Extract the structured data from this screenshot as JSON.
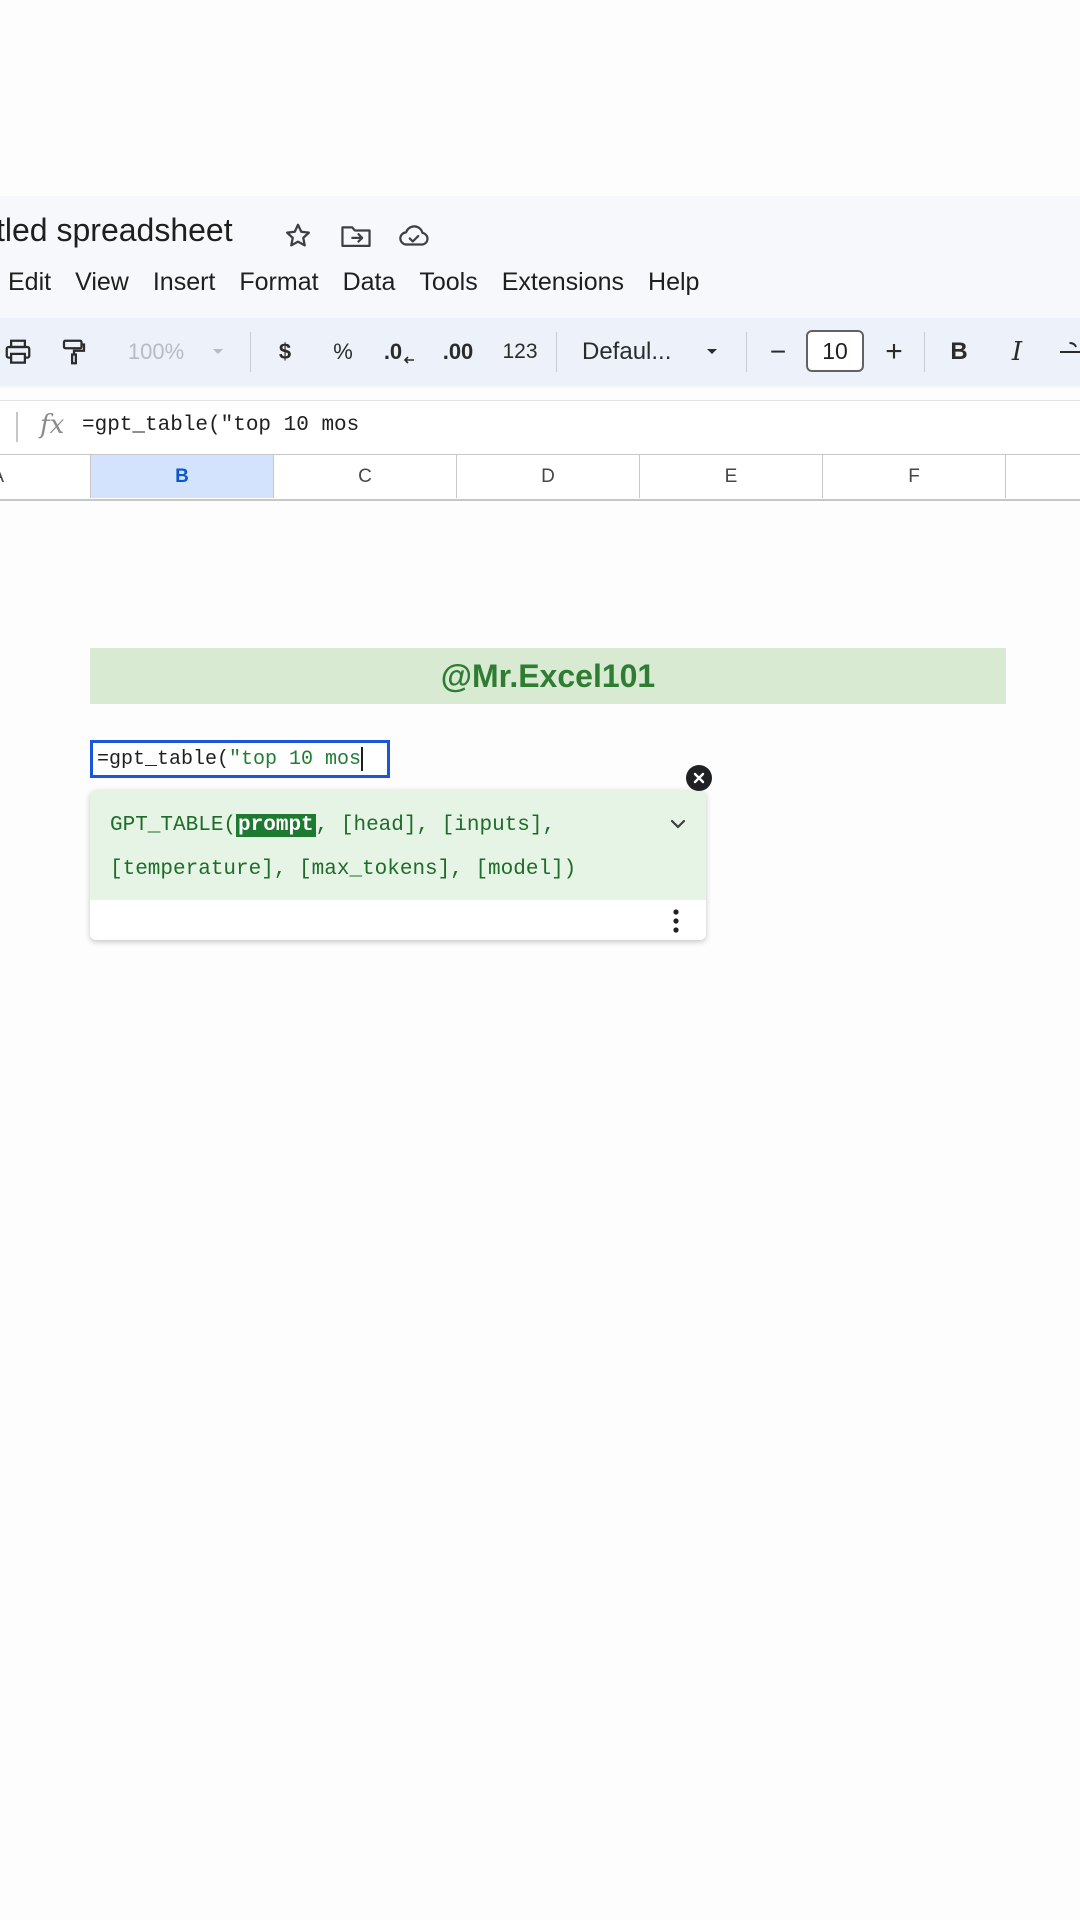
{
  "document": {
    "title": "tled spreadsheet",
    "icons": [
      "star-icon",
      "move-to-folder-icon",
      "cloud-status-icon"
    ]
  },
  "menu": {
    "items": [
      "Edit",
      "View",
      "Insert",
      "Format",
      "Data",
      "Tools",
      "Extensions",
      "Help"
    ]
  },
  "toolbar": {
    "zoom": "100%",
    "currency": "$",
    "percent": "%",
    "decrease_decimal": ".0",
    "increase_decimal": ".00",
    "number_format": "123",
    "font": "Defaul...",
    "font_size": "10",
    "minus": "−",
    "plus": "+",
    "bold": "B",
    "italic": "I"
  },
  "formula_bar": {
    "fx": "fx",
    "value": "=gpt_table(\"top 10 mos"
  },
  "columns": [
    "A",
    "B",
    "C",
    "D",
    "E",
    "F"
  ],
  "active_column": "B",
  "banner": {
    "text": "@Mr.Excel101"
  },
  "cell_editor": {
    "prefix": "=gpt_table(",
    "string_part": "\"top 10 mos"
  },
  "autocomplete": {
    "fn_name": "GPT_TABLE(",
    "active_param": "prompt",
    "line1_rest": ", [head], [inputs],",
    "line2": "[temperature], [max_tokens], [model])"
  },
  "colors": {
    "banner_bg": "#d9ead3",
    "banner_text": "#2e7d32",
    "active_column_bg": "#d3e3fd",
    "cell_border": "#1a56db",
    "param_highlight": "#1e7a31"
  }
}
